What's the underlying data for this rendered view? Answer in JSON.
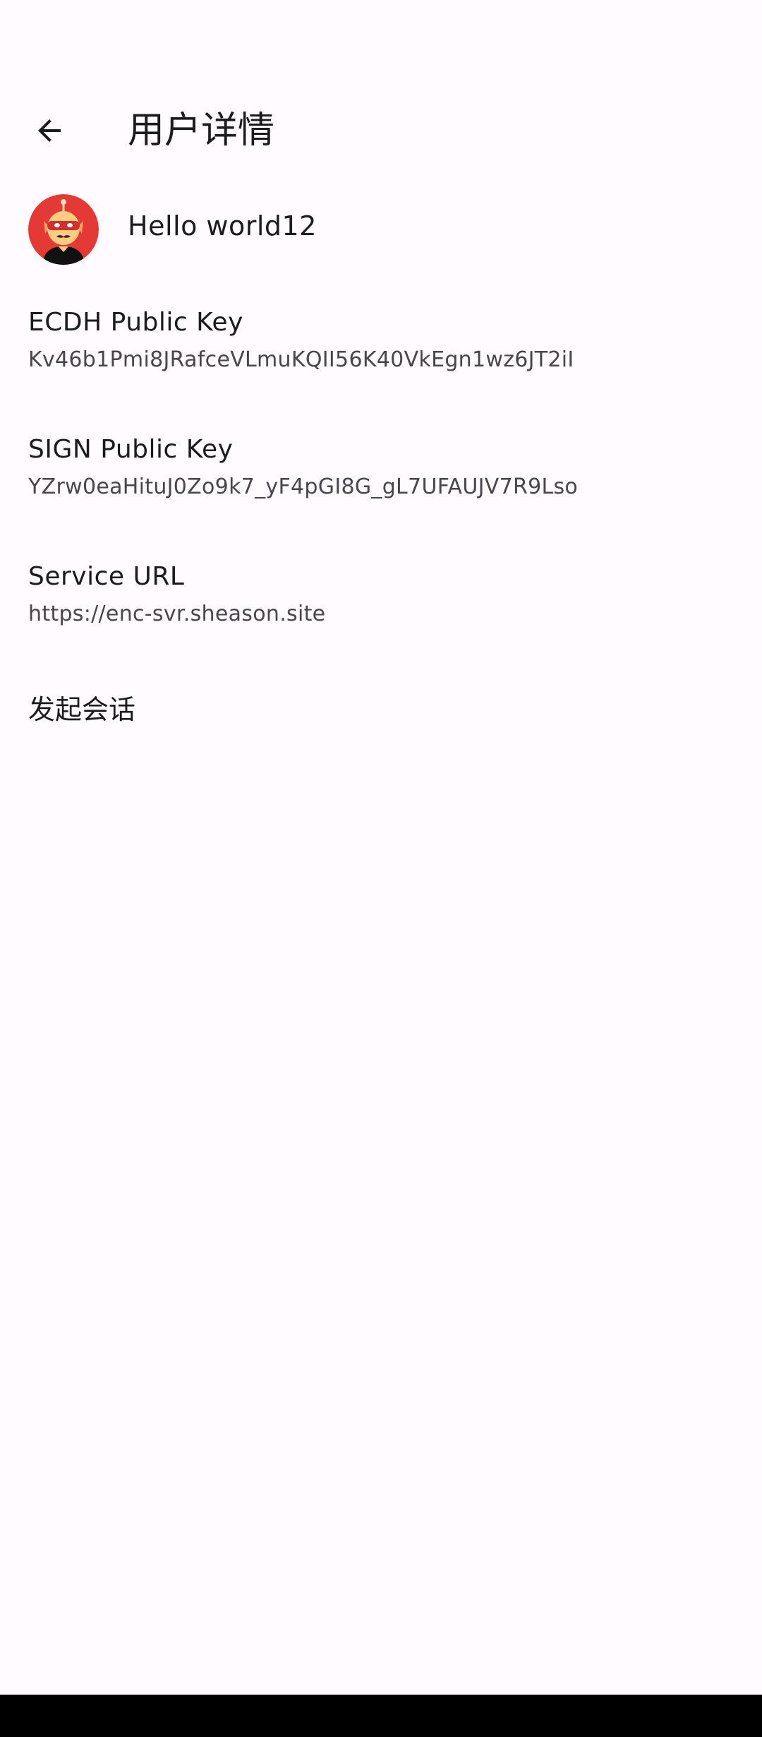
{
  "app_bar": {
    "back_icon": "arrow-back-icon",
    "title": "用户详情"
  },
  "user": {
    "avatar_icon": "robot-avatar",
    "name": "Hello world12"
  },
  "details": [
    {
      "title": "ECDH Public Key",
      "value": "Kv46b1Pmi8JRafceVLmuKQII56K40VkEgn1wz6JT2iI"
    },
    {
      "title": "SIGN Public Key",
      "value": "YZrw0eaHituJ0Zo9k7_yF4pGI8G_gL7UFAUJV7R9Lso"
    },
    {
      "title": "Service URL",
      "value": "https://enc-svr.sheason.site"
    }
  ],
  "actions": {
    "start_chat": "发起会话"
  },
  "colors": {
    "background": "#FFFBFE",
    "text_primary": "#1C1B1F",
    "text_secondary": "#49454F",
    "avatar_bg": "#E53935",
    "nav_bar": "#000000"
  }
}
